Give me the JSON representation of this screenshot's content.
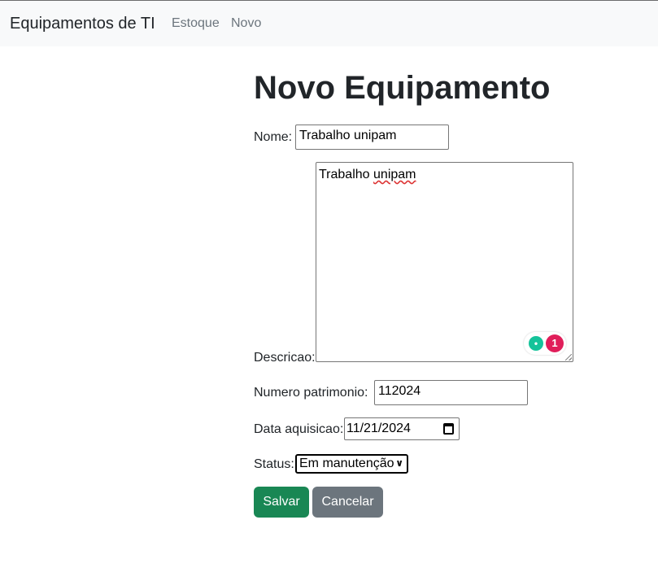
{
  "navbar": {
    "brand": "Equipamentos de TI",
    "links": [
      "Estoque",
      "Novo"
    ]
  },
  "page": {
    "title": "Novo Equipamento"
  },
  "form": {
    "nome": {
      "label": "Nome:",
      "value": "Trabalho unipam"
    },
    "descricao": {
      "label": "Descricao:",
      "value_word1": "Trabalho",
      "value_word2": "unipam",
      "grammar_issue_count": "1"
    },
    "patrimonio": {
      "label": "Numero patrimonio:",
      "value": "112024"
    },
    "data": {
      "label": "Data aquisicao:",
      "value": "11/21/2024"
    },
    "status": {
      "label": "Status:",
      "selected": "Em manutenção"
    }
  },
  "buttons": {
    "save": "Salvar",
    "cancel": "Cancelar"
  },
  "colors": {
    "save": "#198754",
    "cancel": "#6c757d",
    "navbar_bg": "#f8f9fa"
  }
}
